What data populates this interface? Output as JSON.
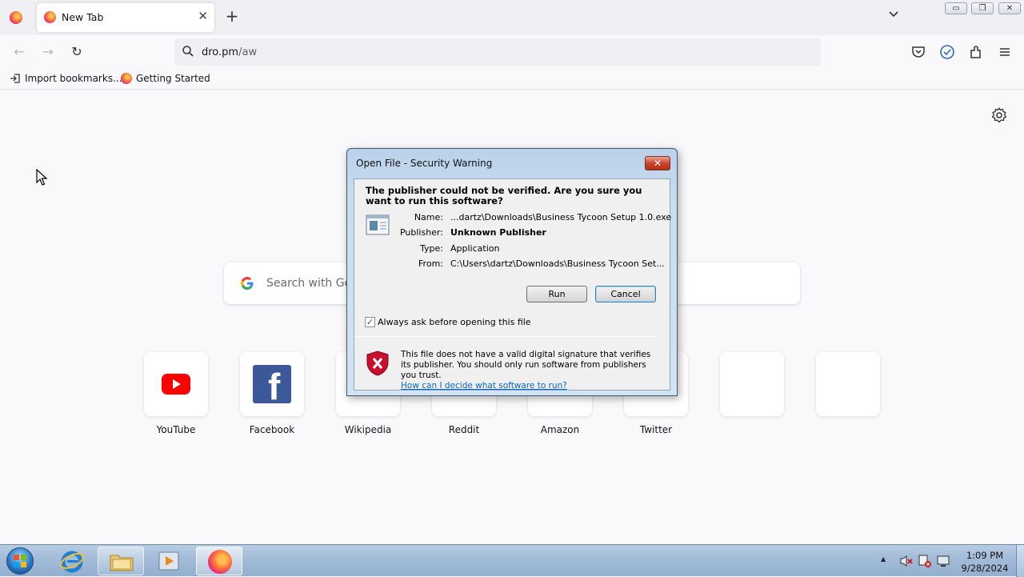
{
  "browser": {
    "tab_title": "New Tab",
    "tab_close_glyph": "✕",
    "new_tab_glyph": "+",
    "tab_list_glyph": "⌄",
    "url_domain": "dro.pm",
    "url_path": "/aw",
    "window_controls": {
      "minimize": "▭",
      "restore": "❐",
      "close": "✕"
    },
    "nav": {
      "back": "←",
      "forward": "→",
      "reload": "↻"
    },
    "bookmarks": [
      {
        "label": "Import bookmarks..."
      },
      {
        "label": "Getting Started"
      }
    ]
  },
  "newtab": {
    "search_placeholder": "Search with Go",
    "shortcuts": [
      {
        "label": "YouTube"
      },
      {
        "label": "Facebook"
      },
      {
        "label": "Wikipedia"
      },
      {
        "label": "Reddit"
      },
      {
        "label": "Amazon"
      },
      {
        "label": "Twitter"
      }
    ],
    "youtube_color": "#ff0000",
    "facebook_color": "#3b5998"
  },
  "dialog": {
    "title": "Open File - Security Warning",
    "close_glyph": "✕",
    "question": "The publisher could not be verified.  Are you sure you want to run this software?",
    "fields": {
      "name_label": "Name:",
      "name_value": "...dartz\\Downloads\\Business Tycoon Setup 1.0.exe",
      "publisher_label": "Publisher:",
      "publisher_value": "Unknown Publisher",
      "type_label": "Type:",
      "type_value": "Application",
      "from_label": "From:",
      "from_value": "C:\\Users\\dartz\\Downloads\\Business Tycoon Set..."
    },
    "run_label": "Run",
    "cancel_label": "Cancel",
    "checkbox_checked": true,
    "checkbox_glyph": "✓",
    "checkbox_label": "Always ask before opening this file",
    "warning_text": "This file does not have a valid digital signature that verifies its publisher.  You should only run software from publishers you trust.",
    "warning_link": "How can I decide what software to run?"
  },
  "taskbar": {
    "time": "1:09 PM",
    "date": "9/28/2024",
    "tray_arrow": "▲"
  }
}
